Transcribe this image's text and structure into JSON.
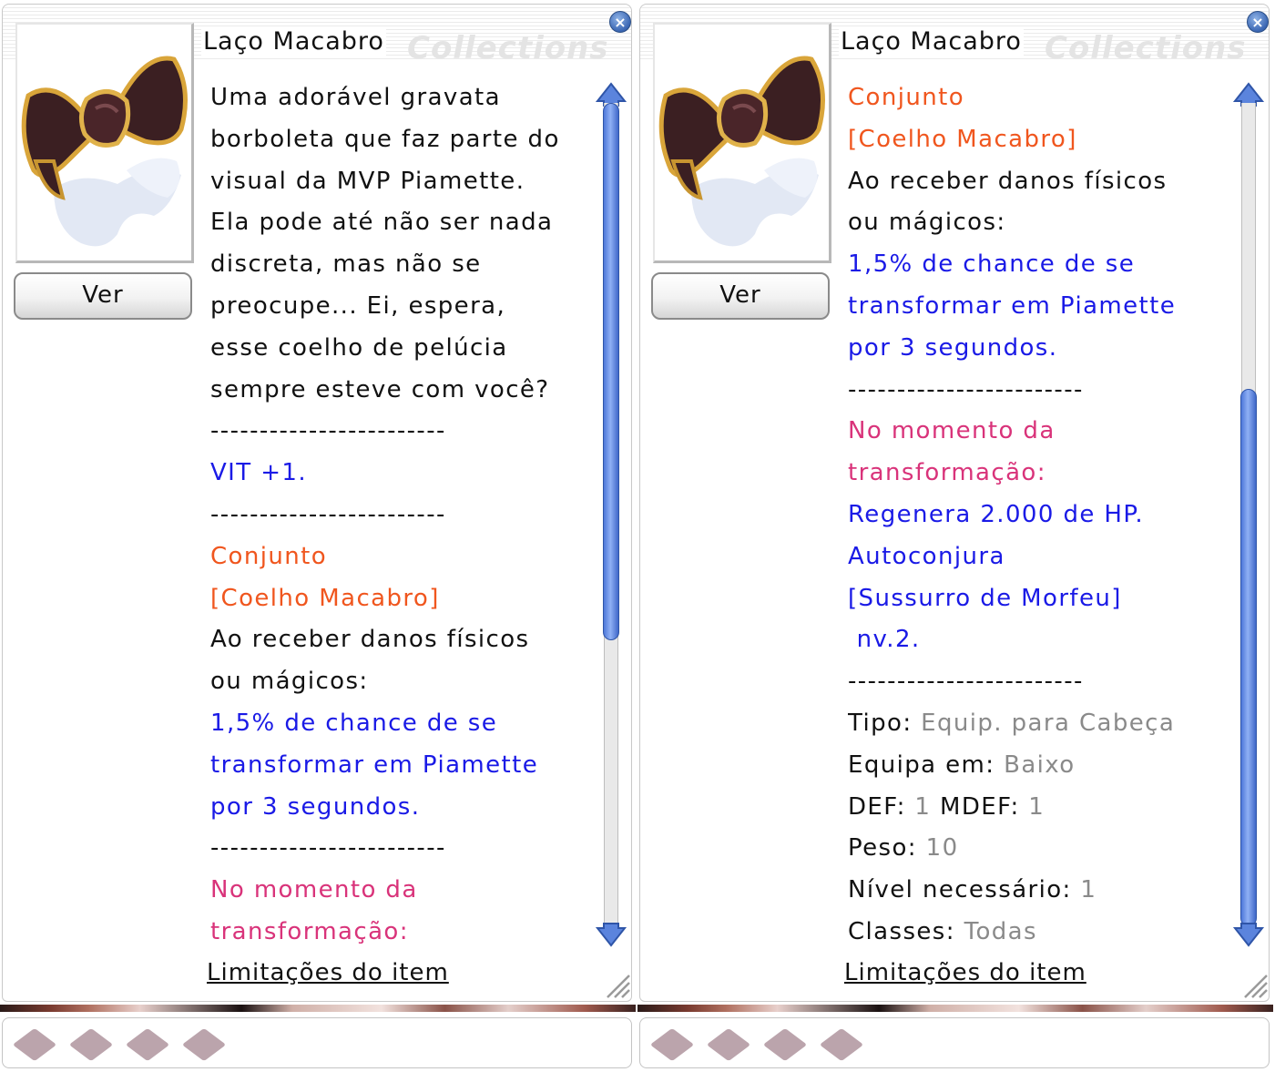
{
  "colors": {
    "text": "#111111",
    "blue": "#1a1ae6",
    "orange": "#f0561e",
    "pink": "#d9337a",
    "gray": "#8a8a8a",
    "scroll_accent": "#4d77d9"
  },
  "icons": {
    "close": "close-icon",
    "item": "bow-ribbon-icon",
    "slot": "card-slot-icon"
  },
  "panels": [
    {
      "title": "Laço Macabro",
      "watermark": "Collections",
      "view_button": "Ver",
      "limits_link": "Limitações do item",
      "scroll_position": 0.0,
      "lines": [
        {
          "runs": [
            {
              "text": "Uma adorável gravata",
              "color": "black"
            }
          ]
        },
        {
          "runs": [
            {
              "text": "borboleta que faz parte do",
              "color": "black"
            }
          ]
        },
        {
          "runs": [
            {
              "text": "visual da MVP Piamette.",
              "color": "black"
            }
          ]
        },
        {
          "runs": [
            {
              "text": "Ela pode até não ser nada",
              "color": "black"
            }
          ]
        },
        {
          "runs": [
            {
              "text": "discreta, mas não se",
              "color": "black"
            }
          ]
        },
        {
          "runs": [
            {
              "text": "preocupe... Ei, espera,",
              "color": "black"
            }
          ]
        },
        {
          "runs": [
            {
              "text": "esse coelho de pelúcia",
              "color": "black"
            }
          ]
        },
        {
          "runs": [
            {
              "text": "sempre esteve com você?",
              "color": "black"
            }
          ]
        },
        {
          "runs": [
            {
              "text": "------------------------",
              "color": "black"
            }
          ]
        },
        {
          "runs": [
            {
              "text": "VIT +1.",
              "color": "blue"
            }
          ]
        },
        {
          "runs": [
            {
              "text": "------------------------",
              "color": "black"
            }
          ]
        },
        {
          "runs": [
            {
              "text": "Conjunto",
              "color": "orange"
            }
          ]
        },
        {
          "runs": [
            {
              "text": "[Coelho Macabro]",
              "color": "orange"
            }
          ]
        },
        {
          "runs": [
            {
              "text": "Ao receber danos físicos",
              "color": "black"
            }
          ]
        },
        {
          "runs": [
            {
              "text": "ou mágicos:",
              "color": "black"
            }
          ]
        },
        {
          "runs": [
            {
              "text": "1,5% de chance de se",
              "color": "blue"
            }
          ]
        },
        {
          "runs": [
            {
              "text": "transformar em Piamette",
              "color": "blue"
            }
          ]
        },
        {
          "runs": [
            {
              "text": "por 3 segundos.",
              "color": "blue"
            }
          ]
        },
        {
          "runs": [
            {
              "text": "------------------------",
              "color": "black"
            }
          ]
        },
        {
          "runs": [
            {
              "text": "No momento da",
              "color": "pink"
            }
          ]
        },
        {
          "runs": [
            {
              "text": "transformação:",
              "color": "pink"
            }
          ]
        }
      ]
    },
    {
      "title": "Laço Macabro",
      "watermark": "Collections",
      "view_button": "Ver",
      "limits_link": "Limitações do item",
      "scroll_position": 1.0,
      "lines": [
        {
          "runs": [
            {
              "text": "Conjunto",
              "color": "orange"
            }
          ]
        },
        {
          "runs": [
            {
              "text": "[Coelho Macabro]",
              "color": "orange"
            }
          ]
        },
        {
          "runs": [
            {
              "text": "Ao receber danos físicos",
              "color": "black"
            }
          ]
        },
        {
          "runs": [
            {
              "text": "ou mágicos:",
              "color": "black"
            }
          ]
        },
        {
          "runs": [
            {
              "text": "1,5% de chance de se",
              "color": "blue"
            }
          ]
        },
        {
          "runs": [
            {
              "text": "transformar em Piamette",
              "color": "blue"
            }
          ]
        },
        {
          "runs": [
            {
              "text": "por 3 segundos.",
              "color": "blue"
            }
          ]
        },
        {
          "runs": [
            {
              "text": "------------------------",
              "color": "black"
            }
          ]
        },
        {
          "runs": [
            {
              "text": "No momento da",
              "color": "pink"
            }
          ]
        },
        {
          "runs": [
            {
              "text": "transformação:",
              "color": "pink"
            }
          ]
        },
        {
          "runs": [
            {
              "text": "Regenera 2.000 de HP.",
              "color": "blue"
            }
          ]
        },
        {
          "runs": [
            {
              "text": "Autoconjura",
              "color": "blue"
            }
          ]
        },
        {
          "runs": [
            {
              "text": "[Sussurro de Morfeu]",
              "color": "blue"
            }
          ]
        },
        {
          "runs": [
            {
              "text": " nv.2.",
              "color": "blue"
            }
          ]
        },
        {
          "runs": [
            {
              "text": "------------------------",
              "color": "black"
            }
          ]
        },
        {
          "runs": [
            {
              "text": "Tipo: ",
              "color": "black"
            },
            {
              "text": "Equip. para Cabeça",
              "color": "gray"
            }
          ]
        },
        {
          "runs": [
            {
              "text": "Equipa em: ",
              "color": "black"
            },
            {
              "text": "Baixo",
              "color": "gray"
            }
          ]
        },
        {
          "runs": [
            {
              "text": "DEF: ",
              "color": "black"
            },
            {
              "text": "1",
              "color": "gray"
            },
            {
              "text": " MDEF: ",
              "color": "black"
            },
            {
              "text": "1",
              "color": "gray"
            }
          ]
        },
        {
          "runs": [
            {
              "text": "Peso: ",
              "color": "black"
            },
            {
              "text": "10",
              "color": "gray"
            }
          ]
        },
        {
          "runs": [
            {
              "text": "Nível necessário: ",
              "color": "black"
            },
            {
              "text": "1",
              "color": "gray"
            }
          ]
        },
        {
          "runs": [
            {
              "text": "Classes: ",
              "color": "black"
            },
            {
              "text": "Todas",
              "color": "gray"
            }
          ]
        }
      ]
    }
  ]
}
